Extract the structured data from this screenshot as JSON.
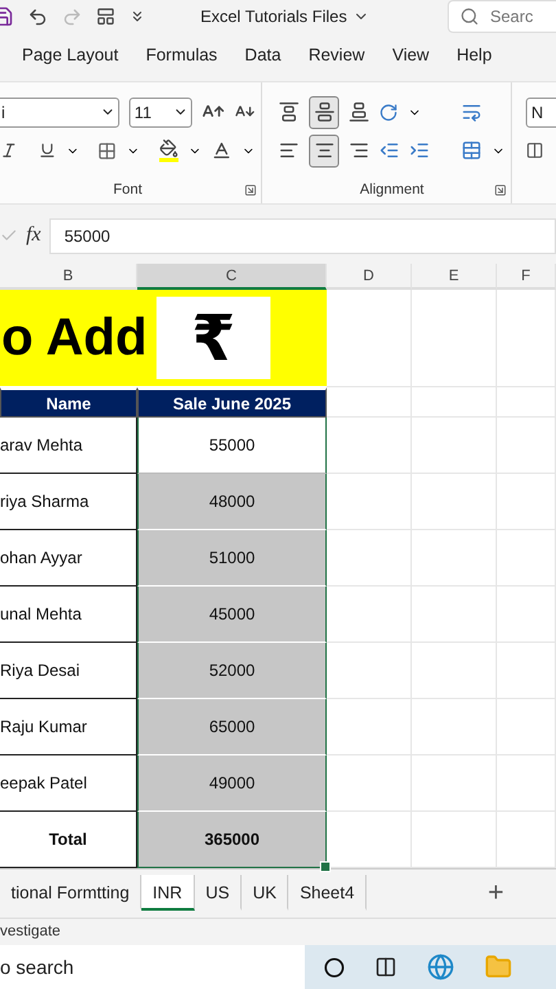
{
  "title_bar": {
    "title": "Excel Tutorials Files",
    "search": {
      "placeholder": "Searc"
    }
  },
  "ribbon_tabs": [
    {
      "label": "Page Layout",
      "selected": false
    },
    {
      "label": "Formulas",
      "selected": false
    },
    {
      "label": "Data",
      "selected": false
    },
    {
      "label": "Review",
      "selected": false
    },
    {
      "label": "View",
      "selected": false
    },
    {
      "label": "Help",
      "selected": false
    }
  ],
  "ribbon": {
    "font_name": "i",
    "font_size": "11",
    "groups": [
      "Font",
      "Alignment"
    ],
    "number_format": "N",
    "align_center_on": true,
    "align_middle_on": true
  },
  "formula_bar": {
    "fx": "fx",
    "value": "55000"
  },
  "columns": [
    {
      "label": "B",
      "selected": false
    },
    {
      "label": "C",
      "selected": true
    },
    {
      "label": "D",
      "selected": false
    },
    {
      "label": "E",
      "selected": false
    },
    {
      "label": "F",
      "selected": false
    }
  ],
  "banner": {
    "text": "o Add",
    "symbol": "₹"
  },
  "table": {
    "columns": [
      "Name",
      "Sale June 2025"
    ],
    "rows": [
      {
        "kind": "data",
        "name": "arav Mehta",
        "value": "55000",
        "active": true
      },
      {
        "kind": "data",
        "name": "riya Sharma",
        "value": "48000",
        "active": false
      },
      {
        "kind": "data",
        "name": "ohan Ayyar",
        "value": "51000",
        "active": false
      },
      {
        "kind": "data",
        "name": "unal Mehta",
        "value": "45000",
        "active": false
      },
      {
        "kind": "data",
        "name": "Riya Desai",
        "value": "52000",
        "active": false
      },
      {
        "kind": "data",
        "name": "Raju Kumar",
        "value": "65000",
        "active": false
      },
      {
        "kind": "data",
        "name": "eepak Patel",
        "value": "49000",
        "active": false
      },
      {
        "kind": "total",
        "name": "Total",
        "value": "365000",
        "active": false
      }
    ]
  },
  "sheet_tabs": [
    {
      "label": "tional Formtting",
      "selected": false
    },
    {
      "label": "INR",
      "selected": true
    },
    {
      "label": "US",
      "selected": false
    },
    {
      "label": "UK",
      "selected": false
    },
    {
      "label": "Sheet4",
      "selected": false
    }
  ],
  "add_sheet": "+",
  "status_bar": {
    "text": "vestigate"
  },
  "taskbar": {
    "search": "o search"
  }
}
